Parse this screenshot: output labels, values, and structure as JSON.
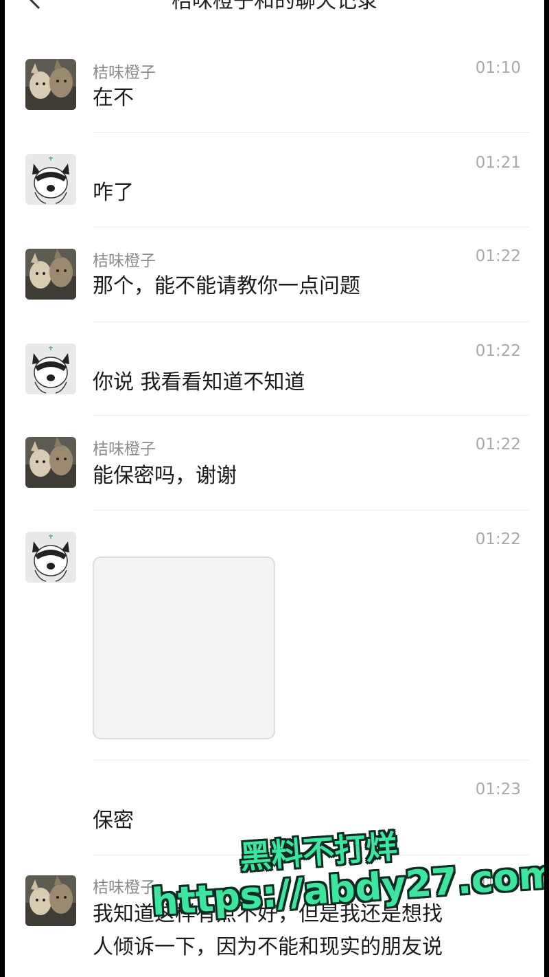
{
  "header": {
    "title": "桔味橙子和的聊天记录",
    "more": "···"
  },
  "contact": {
    "name": "桔味橙子"
  },
  "messages": [
    {
      "sender": "桔味橙子",
      "time": "01:10",
      "text": "在不",
      "avatar": "dogs-avatar"
    },
    {
      "sender": "",
      "time": "01:21",
      "text": "咋了",
      "avatar": "cat-avatar"
    },
    {
      "sender": "桔味橙子",
      "time": "01:22",
      "text": "那个，能不能请教你一点问题",
      "avatar": "dogs-avatar"
    },
    {
      "sender": "",
      "time": "01:22",
      "text": "你说 我看看知道不知道",
      "avatar": "cat-avatar"
    },
    {
      "sender": "桔味橙子",
      "time": "01:22",
      "text": "能保密吗，谢谢",
      "avatar": "dogs-avatar"
    },
    {
      "sender": "",
      "time": "01:22",
      "text": "",
      "avatar": "cat-avatar",
      "image": "image-placeholder"
    },
    {
      "sender": "",
      "time": "01:23",
      "text": "保密",
      "avatar": ""
    },
    {
      "sender": "桔味橙子",
      "time": "01:23",
      "text": "我知道这样有点不好，但是我还是想找",
      "text2": "人倾诉一下，因为不能和现实的朋友说",
      "avatar": "dogs-avatar"
    }
  ],
  "watermark": {
    "line1": "黑料不打烊",
    "line2": "https://abdy27.com",
    "color": "#3de6a0"
  }
}
